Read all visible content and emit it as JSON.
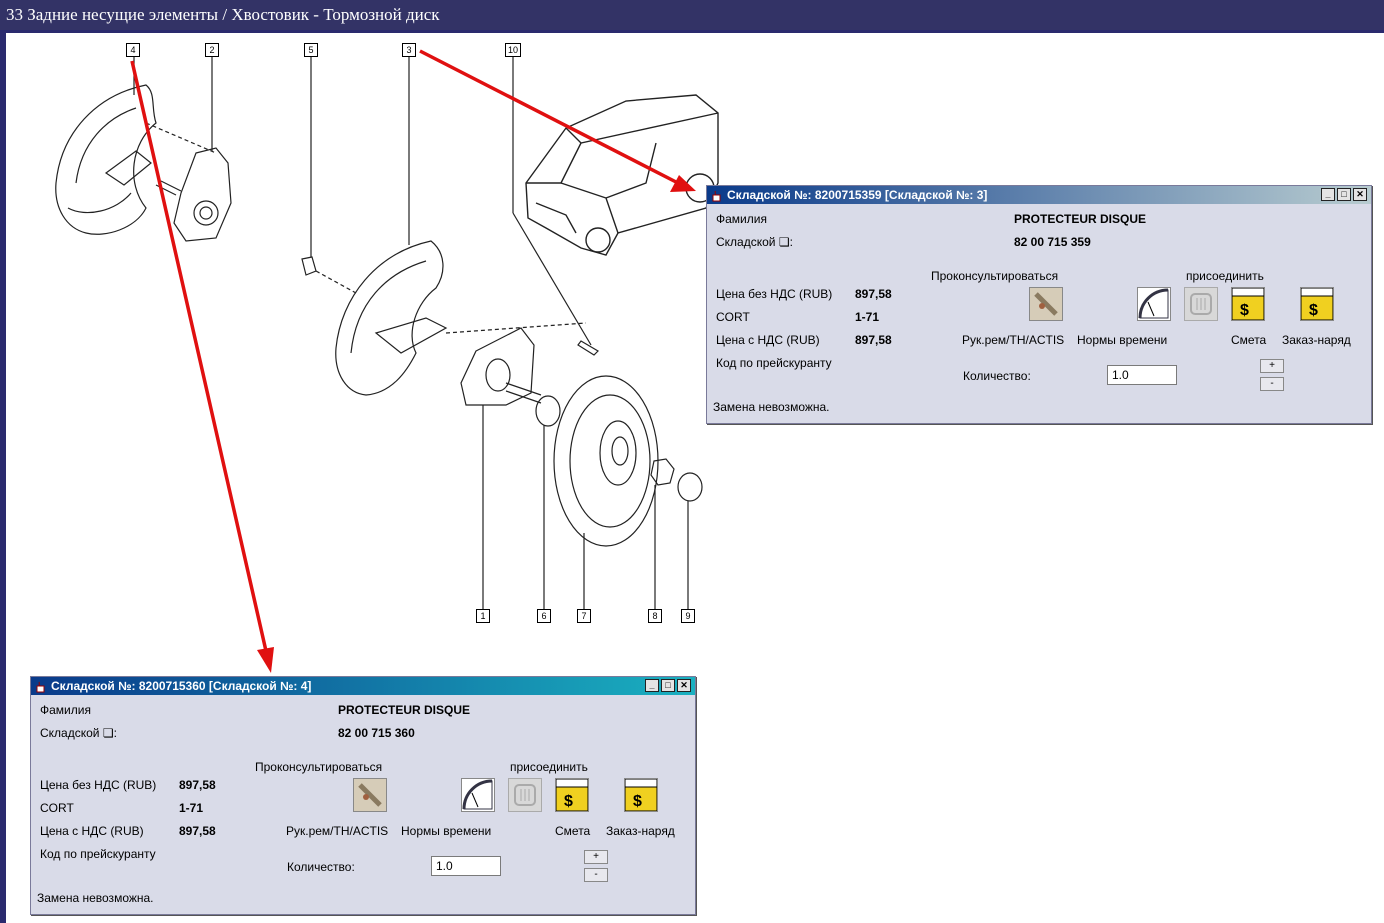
{
  "app": {
    "title": "33 Задние несущие элементы / Хвостовик - Тормозной диск"
  },
  "callouts": [
    "4",
    "2",
    "5",
    "3",
    "10",
    "1",
    "6",
    "7",
    "8",
    "9"
  ],
  "windows": [
    {
      "title": "Складской №: 8200715359 [Складской №: 3]",
      "title_gradient": [
        "#0a3a8a",
        "#b8ccd0"
      ],
      "family_label": "Фамилия",
      "family_value": "PROTECTEUR DISQUE",
      "stock_label": "Складской ❏:",
      "stock_value": "82 00 715 359",
      "price_net_label": "Цена без НДС (RUB)",
      "price_net_value": "897,58",
      "cort_label": "CORT",
      "cort_value": "1-71",
      "price_vat_label": "Цена с НДС (RUB)",
      "price_vat_value": "897,58",
      "price_code_label": "Код по прейскуранту",
      "consult_label": "Проконсультироваться",
      "attach_label": "присоединить",
      "manual_label": "Рук.рем/TH/ACTIS",
      "norms_label": "Нормы времени",
      "estimate_label": "Смета",
      "order_label": "Заказ-наряд",
      "qty_label": "Количество:",
      "qty_value": "1.0",
      "plus": "+",
      "minus": "-",
      "status": "Замена невозможна."
    },
    {
      "title": "Складской №: 8200715360 [Складской №: 4]",
      "title_gradient": [
        "#0a3a8a",
        "#1ab0c0"
      ],
      "family_label": "Фамилия",
      "family_value": "PROTECTEUR DISQUE",
      "stock_label": "Складской ❏:",
      "stock_value": "82 00 715 360",
      "price_net_label": "Цена без НДС (RUB)",
      "price_net_value": "897,58",
      "cort_label": "CORT",
      "cort_value": "1-71",
      "price_vat_label": "Цена с НДС (RUB)",
      "price_vat_value": "897,58",
      "price_code_label": "Код по прейскуранту",
      "consult_label": "Проконсультироваться",
      "attach_label": "присоединить",
      "manual_label": "Рук.рем/TH/ACTIS",
      "norms_label": "Нормы времени",
      "estimate_label": "Смета",
      "order_label": "Заказ-наряд",
      "qty_label": "Количество:",
      "qty_value": "1.0",
      "plus": "+",
      "minus": "-",
      "status": "Замена невозможна."
    }
  ],
  "colors": {
    "arrow": "#e01010",
    "titlebar": "#333366",
    "window_bg": "#d9dbe8"
  }
}
